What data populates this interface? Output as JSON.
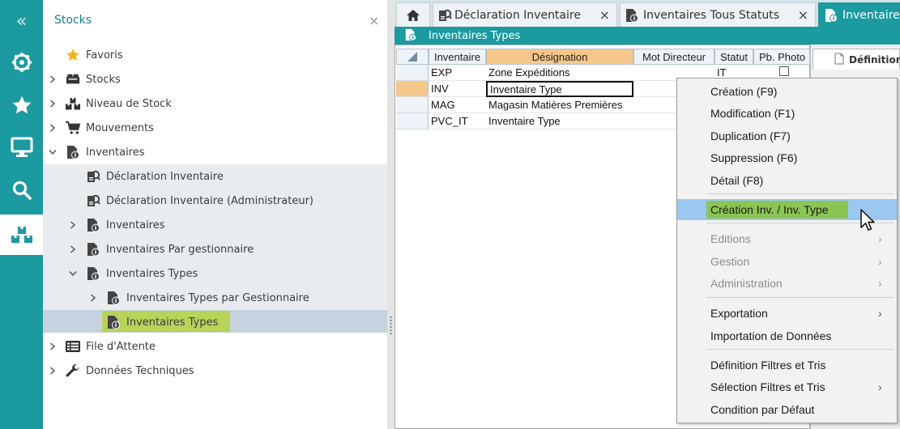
{
  "sidebar_icons": [
    {
      "name": "collapse-icon",
      "glyph": "«"
    },
    {
      "name": "dashboard-icon"
    },
    {
      "name": "favorites-star-icon"
    },
    {
      "name": "monitor-icon"
    },
    {
      "name": "search-icon"
    },
    {
      "name": "stocks-boxes-icon"
    }
  ],
  "nav": {
    "title": "Stocks",
    "close": "×",
    "items": [
      {
        "label": "Favoris",
        "icon": "star-icon"
      },
      {
        "label": "Stocks",
        "icon": "boxes-icon"
      },
      {
        "label": "Niveau de Stock",
        "icon": "stock-level-icon"
      },
      {
        "label": "Mouvements",
        "icon": "cart-icon"
      },
      {
        "label": "Inventaires",
        "icon": "inventory-doc-icon"
      },
      {
        "label": "Déclaration Inventaire",
        "icon": "declaration-icon"
      },
      {
        "label": "Déclaration Inventaire (Administrateur)",
        "icon": "declaration-icon"
      },
      {
        "label": "Inventaires",
        "icon": "inventory-doc-icon"
      },
      {
        "label": "Inventaires Par gestionnaire",
        "icon": "inventory-doc-icon"
      },
      {
        "label": "Inventaires Types",
        "icon": "inventory-doc-icon"
      },
      {
        "label": "Inventaires Types par Gestionnaire",
        "icon": "inventory-doc-icon"
      },
      {
        "label": "Inventaires Types",
        "icon": "inventory-doc-icon"
      },
      {
        "label": "File d'Attente",
        "icon": "list-icon"
      },
      {
        "label": "Données Techniques",
        "icon": "wrench-icon"
      }
    ]
  },
  "tabs": [
    {
      "label": "Déclaration Inventaire",
      "close": "×"
    },
    {
      "label": "Inventaires Tous Statuts",
      "close": "×"
    },
    {
      "label": "Inventaires"
    }
  ],
  "subheader": {
    "title": "Inventaires Types"
  },
  "grid": {
    "columns": [
      "Inventaire",
      "Désignation",
      "Mot Directeur",
      "Statut",
      "Pb. Photo"
    ],
    "rows": [
      {
        "inventaire": "EXP",
        "designation": "Zone Expéditions",
        "mot_directeur": "",
        "statut": "IT"
      },
      {
        "inventaire": "INV",
        "designation": "Inventaire Type",
        "mot_directeur": "",
        "statut": ""
      },
      {
        "inventaire": "MAG",
        "designation": "Magasin Matières Premières",
        "mot_directeur": "",
        "statut": ""
      },
      {
        "inventaire": "PVC_IT",
        "designation": "Inventaire Type",
        "mot_directeur": "",
        "statut": ""
      }
    ]
  },
  "definition_tab": {
    "label": "Définition"
  },
  "context_menu": {
    "items": [
      {
        "label": "Création (F9)"
      },
      {
        "label": "Modification (F1)"
      },
      {
        "label": "Duplication (F7)"
      },
      {
        "label": "Suppression (F6)"
      },
      {
        "label": "Détail (F8)"
      },
      {
        "label": "Création Inv. / Inv. Type"
      },
      {
        "label": "Editions",
        "submenu": "›"
      },
      {
        "label": "Gestion",
        "submenu": "›"
      },
      {
        "label": "Administration",
        "submenu": "›"
      },
      {
        "label": "Exportation",
        "submenu": "›"
      },
      {
        "label": "Importation de Données"
      },
      {
        "label": "Définition Filtres et Tris"
      },
      {
        "label": "Sélection Filtres et Tris",
        "submenu": "›"
      },
      {
        "label": "Condition par Défaut"
      }
    ]
  },
  "colors": {
    "accent": "#1b9aa0",
    "selection_highlight": "#b8d35a",
    "menu_hover": "#9bc8f0",
    "sorted_column": "#f6c78a"
  }
}
